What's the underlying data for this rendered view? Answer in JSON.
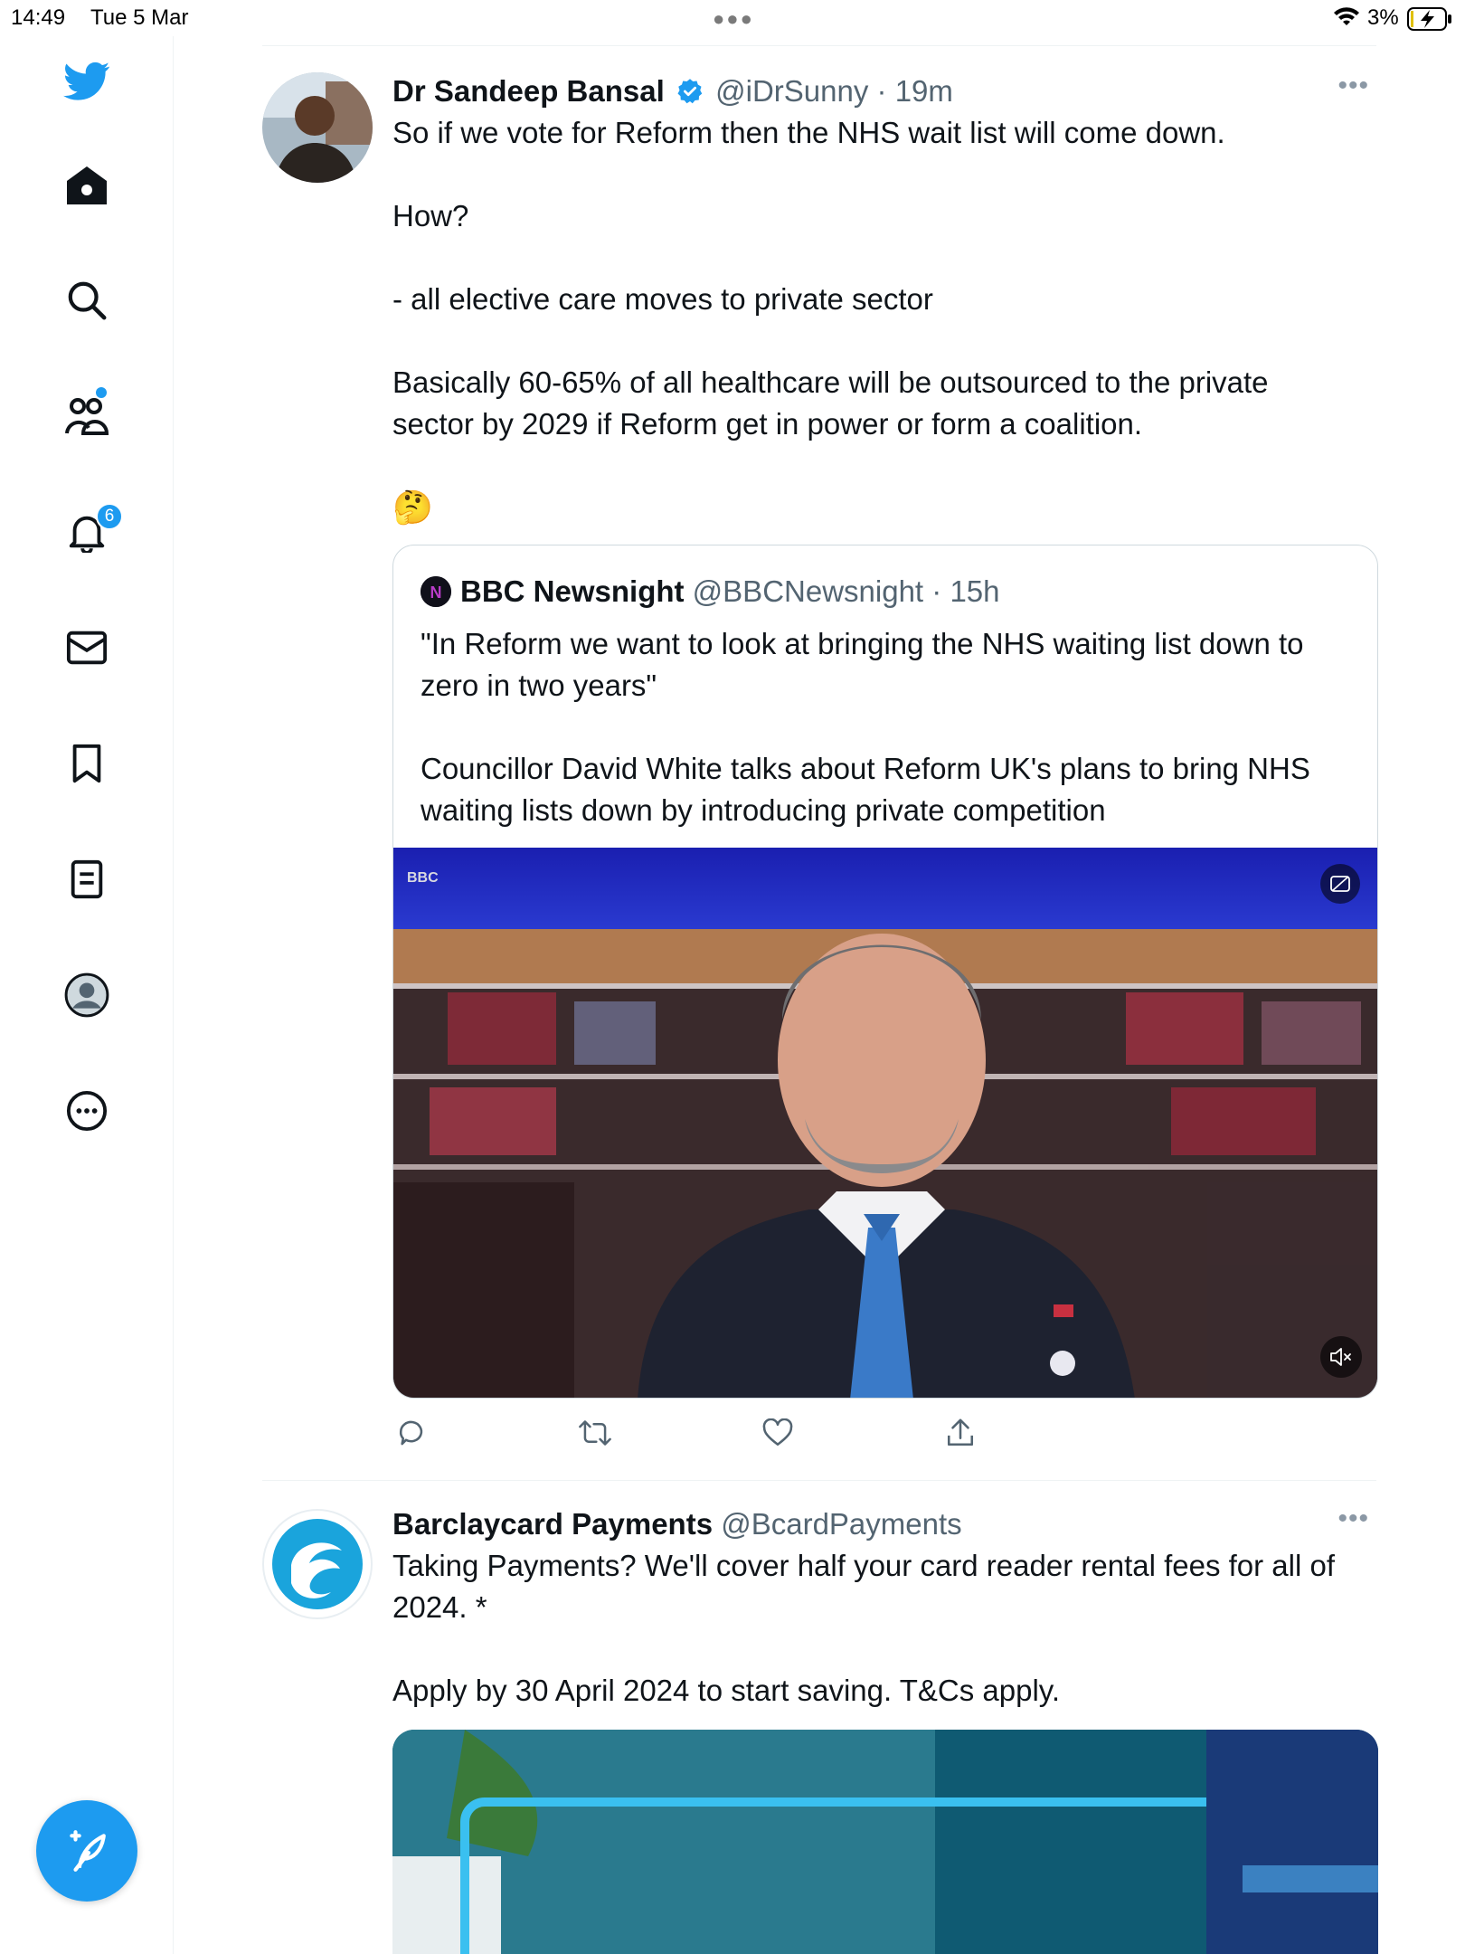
{
  "status_bar": {
    "time": "14:49",
    "date": "Tue 5 Mar",
    "battery": "3%"
  },
  "sidebar": {
    "notifications_badge": "6",
    "items": [
      {
        "icon": "twitter-logo-icon"
      },
      {
        "icon": "home-icon"
      },
      {
        "icon": "search-icon"
      },
      {
        "icon": "communities-icon"
      },
      {
        "icon": "bell-icon"
      },
      {
        "icon": "mail-icon"
      },
      {
        "icon": "bookmark-icon"
      },
      {
        "icon": "lists-icon"
      },
      {
        "icon": "profile-icon"
      },
      {
        "icon": "more-circle-icon"
      }
    ],
    "compose_icon": "compose-feather-icon"
  },
  "colors": {
    "accent": "#1d9bf0",
    "text": "#0f1419",
    "muted": "#536471",
    "border": "#cfd9de"
  },
  "tweet1": {
    "name": "Dr Sandeep Bansal",
    "handle": "@iDrSunny",
    "time": "· 19m",
    "text": "So if we vote for Reform then the NHS wait list will come down.\n\nHow?\n\n- all elective care moves to private sector\n\nBasically 60-65% of all healthcare will be outsourced to the private sector by 2029 if Reform get in power or form a coalition.",
    "emoji": "🤔",
    "quote": {
      "name": "BBC Newsnight",
      "handle": "@BBCNewsnight",
      "time": "· 15h",
      "text": "\"In Reform we want to look at bringing the NHS waiting list down to zero in two years\"\n\nCouncillor David White talks about Reform UK's plans to bring NHS waiting lists down by introducing private competition",
      "video_watermark": "BBC"
    }
  },
  "tweet2": {
    "name": "Barclaycard Payments",
    "handle": "@BcardPayments",
    "text": "Taking Payments? We'll cover half your card reader rental fees for all of 2024. *\n\nApply by 30 April 2024 to start saving. T&Cs apply."
  }
}
